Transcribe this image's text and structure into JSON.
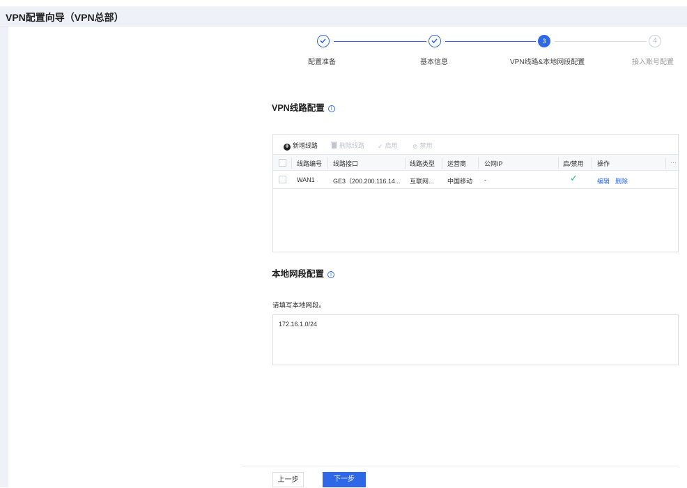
{
  "window": {
    "title": "VPN配置向导（VPN总部）"
  },
  "steps": [
    {
      "label": "配置准备",
      "state": "done"
    },
    {
      "label": "基本信息",
      "state": "done"
    },
    {
      "label": "VPN线路&本地网段配置",
      "state": "active",
      "number": "3"
    },
    {
      "label": "接入账号配置",
      "state": "todo",
      "number": "4"
    }
  ],
  "vpn_section": {
    "title": "VPN线路配置",
    "info_icon": "ⓘ"
  },
  "toolbar": {
    "add_line": "新增线路",
    "delete_line": "删除线路",
    "enable": "启用",
    "disable": "禁用"
  },
  "table": {
    "columns": [
      "线路编号",
      "线路接口",
      "线路类型",
      "运营商",
      "公网IP",
      "启/禁用",
      "操作"
    ],
    "more": "···",
    "rows": [
      {
        "line_no": "WAN1",
        "interface": "GE3（200.200.116.14...",
        "type": "互联网...",
        "carrier": "中国移动",
        "public_ip": "-",
        "enabled": "✓",
        "edit": "编辑",
        "delete": "删除"
      }
    ]
  },
  "local_section": {
    "title": "本地网段配置",
    "info_icon": "ⓘ"
  },
  "hint": "请填写本地网段。",
  "subnet_value": "172.16.1.0/24",
  "buttons": {
    "prev": "上一步",
    "next": "下一步"
  },
  "colors": {
    "accent": "#2f68e6",
    "success": "#30b66b",
    "title_bar": "#eef2f8"
  }
}
